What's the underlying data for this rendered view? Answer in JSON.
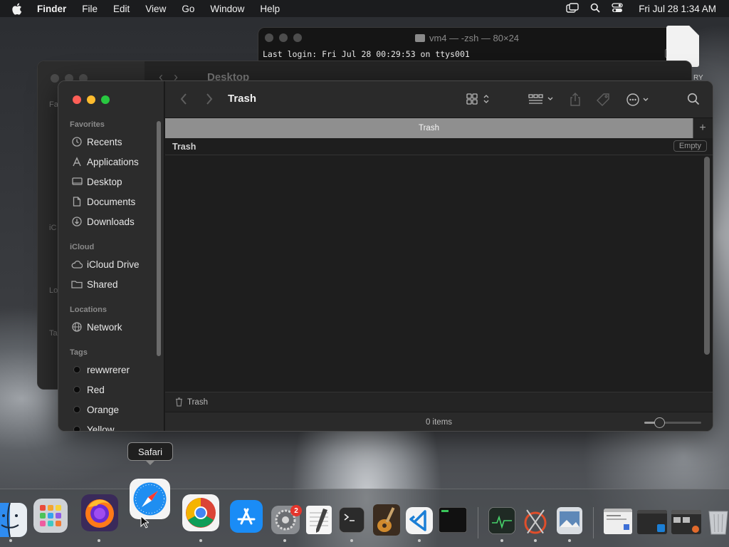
{
  "menubar": {
    "app_name": "Finder",
    "items": [
      "File",
      "Edit",
      "View",
      "Go",
      "Window",
      "Help"
    ],
    "clock": "Fri Jul 28  1:34 AM",
    "status_icons": [
      "screen-mirroring-icon",
      "spotlight-search-icon",
      "control-center-icon"
    ]
  },
  "terminal": {
    "title": "vm4 — -zsh — 80×24",
    "last_login": "Last login: Fri Jul 28 00:29:53 on ttys001"
  },
  "desktop_file": {
    "label": "RY"
  },
  "bg_finder": {
    "title": "Desktop",
    "sidebar_ghost": [
      "Fa",
      "iC",
      "Lo",
      "Ta"
    ]
  },
  "finder": {
    "title": "Trash",
    "sidebar": {
      "sections": [
        {
          "heading": "Favorites",
          "items": [
            {
              "label": "Recents",
              "icon": "clock-icon"
            },
            {
              "label": "Applications",
              "icon": "applications-icon"
            },
            {
              "label": "Desktop",
              "icon": "desktop-icon"
            },
            {
              "label": "Documents",
              "icon": "document-icon"
            },
            {
              "label": "Downloads",
              "icon": "download-icon"
            }
          ]
        },
        {
          "heading": "iCloud",
          "items": [
            {
              "label": "iCloud Drive",
              "icon": "cloud-icon"
            },
            {
              "label": "Shared",
              "icon": "shared-folder-icon"
            }
          ]
        },
        {
          "heading": "Locations",
          "items": [
            {
              "label": "Network",
              "icon": "globe-icon"
            }
          ]
        },
        {
          "heading": "Tags",
          "items": [
            {
              "label": "rewwrerer",
              "icon": "tag-dot-icon"
            },
            {
              "label": "Red",
              "icon": "tag-dot-icon"
            },
            {
              "label": "Orange",
              "icon": "tag-dot-icon"
            },
            {
              "label": "Yellow",
              "icon": "tag-dot-icon"
            }
          ]
        }
      ]
    },
    "tab_label": "Trash",
    "tab_add": "+",
    "location_header": "Trash",
    "empty_button": "Empty",
    "path_label": "Trash",
    "status": "0 items"
  },
  "dock": {
    "tooltip": "Safari",
    "settings_badge": "2",
    "apps": [
      "Finder",
      "Launchpad",
      "Firefox",
      "Safari",
      "Google Chrome",
      "App Store",
      "System Settings",
      "TextEdit",
      "Terminal",
      "GarageBand",
      "Visual Studio Code",
      "Script Editor",
      "Activity Monitor",
      "Instruments",
      "Preview"
    ]
  }
}
